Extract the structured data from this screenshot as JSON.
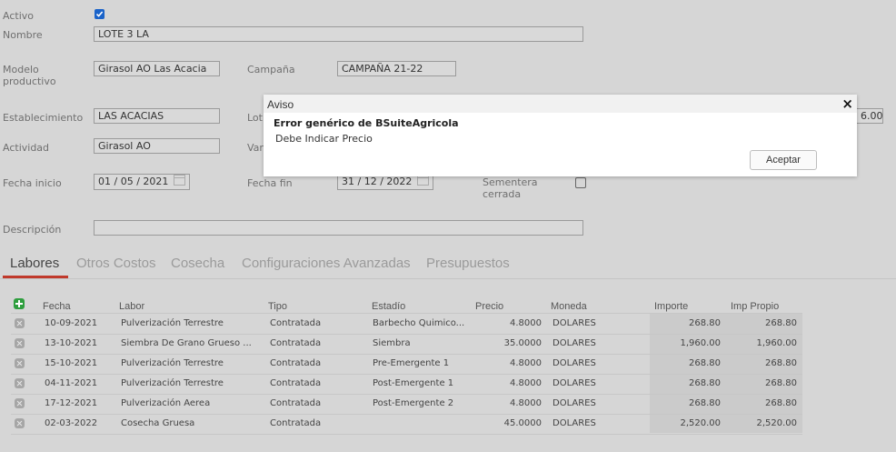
{
  "form": {
    "activo_label": "Activo",
    "activo_checked": true,
    "nombre_label": "Nombre",
    "nombre_value": "LOTE 3 LA",
    "modelo_label_1": "Modelo",
    "modelo_label_2": "productivo",
    "modelo_value": "Girasol AO Las Acacia",
    "campana_label": "Campaña",
    "campana_value": "CAMPAÑA 21-22",
    "establecimiento_label": "Establecimiento",
    "establecimiento_value": "LAS ACACIAS",
    "lote_label_partial": "Lot",
    "hidden_value_partial": "6.00",
    "actividad_label": "Actividad",
    "actividad_value": "Girasol AO",
    "variedad_label_partial": "Var",
    "fecha_inicio_label": "Fecha inicio",
    "fecha_inicio_value": "01 / 05 / 2021",
    "fecha_fin_label": "Fecha fin",
    "fecha_fin_value": "31 / 12 / 2022",
    "sementera_label_1": "Sementera",
    "sementera_label_2": "cerrada",
    "sementera_checked": false,
    "descripcion_label": "Descripción",
    "descripcion_value": ""
  },
  "tabs": [
    {
      "label": "Labores",
      "active": true
    },
    {
      "label": "Otros Costos",
      "active": false
    },
    {
      "label": "Cosecha",
      "active": false
    },
    {
      "label": "Configuraciones Avanzadas",
      "active": false
    },
    {
      "label": "Presupuestos",
      "active": false
    }
  ],
  "table": {
    "headers": [
      "Fecha",
      "Labor",
      "Tipo",
      "Estadío",
      "Precio",
      "Moneda",
      "Importe",
      "Imp Propio"
    ],
    "rows": [
      [
        "10-09-2021",
        "Pulverización Terrestre",
        "Contratada",
        "Barbecho Quimico...",
        "4.8000",
        "DOLARES",
        "268.80",
        "268.80"
      ],
      [
        "13-10-2021",
        "Siembra De Grano Grueso ...",
        "Contratada",
        "Siembra",
        "35.0000",
        "DOLARES",
        "1,960.00",
        "1,960.00"
      ],
      [
        "15-10-2021",
        "Pulverización Terrestre",
        "Contratada",
        "Pre-Emergente 1",
        "4.8000",
        "DOLARES",
        "268.80",
        "268.80"
      ],
      [
        "04-11-2021",
        "Pulverización Terrestre",
        "Contratada",
        "Post-Emergente 1",
        "4.8000",
        "DOLARES",
        "268.80",
        "268.80"
      ],
      [
        "17-12-2021",
        "Pulverización Aerea",
        "Contratada",
        "Post-Emergente 2",
        "4.8000",
        "DOLARES",
        "268.80",
        "268.80"
      ],
      [
        "02-03-2022",
        "Cosecha Gruesa",
        "Contratada",
        "",
        "45.0000",
        "DOLARES",
        "2,520.00",
        "2,520.00"
      ]
    ]
  },
  "modal": {
    "title": "Aviso",
    "close": "×",
    "message_title": "Error genérico de BSuiteAgricola",
    "message": "Debe Indicar Precio",
    "accept_label": "Aceptar"
  },
  "colors": {
    "accent": "#c0392b",
    "checkbox": "#1a63c9",
    "add": "#2e9e3e"
  }
}
